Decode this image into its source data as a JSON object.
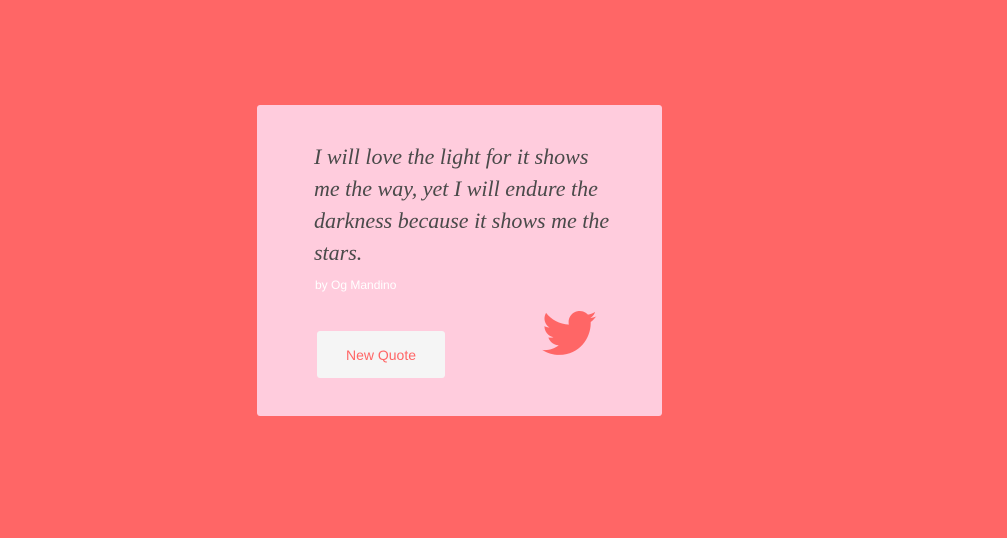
{
  "colors": {
    "background": "#ff6666",
    "card": "#ffccdd",
    "quote_text": "#4a4a4a",
    "author_text": "#ffffff",
    "button_bg": "#f5f5f5",
    "button_text": "#ff6666",
    "twitter_icon": "#ff6666"
  },
  "quote": {
    "text": "I will love the light for it shows me the way, yet I will endure the darkness because it shows me the stars.",
    "author": "by Og Mandino"
  },
  "actions": {
    "new_quote_label": "New Quote",
    "tweet_icon": "twitter-icon"
  }
}
